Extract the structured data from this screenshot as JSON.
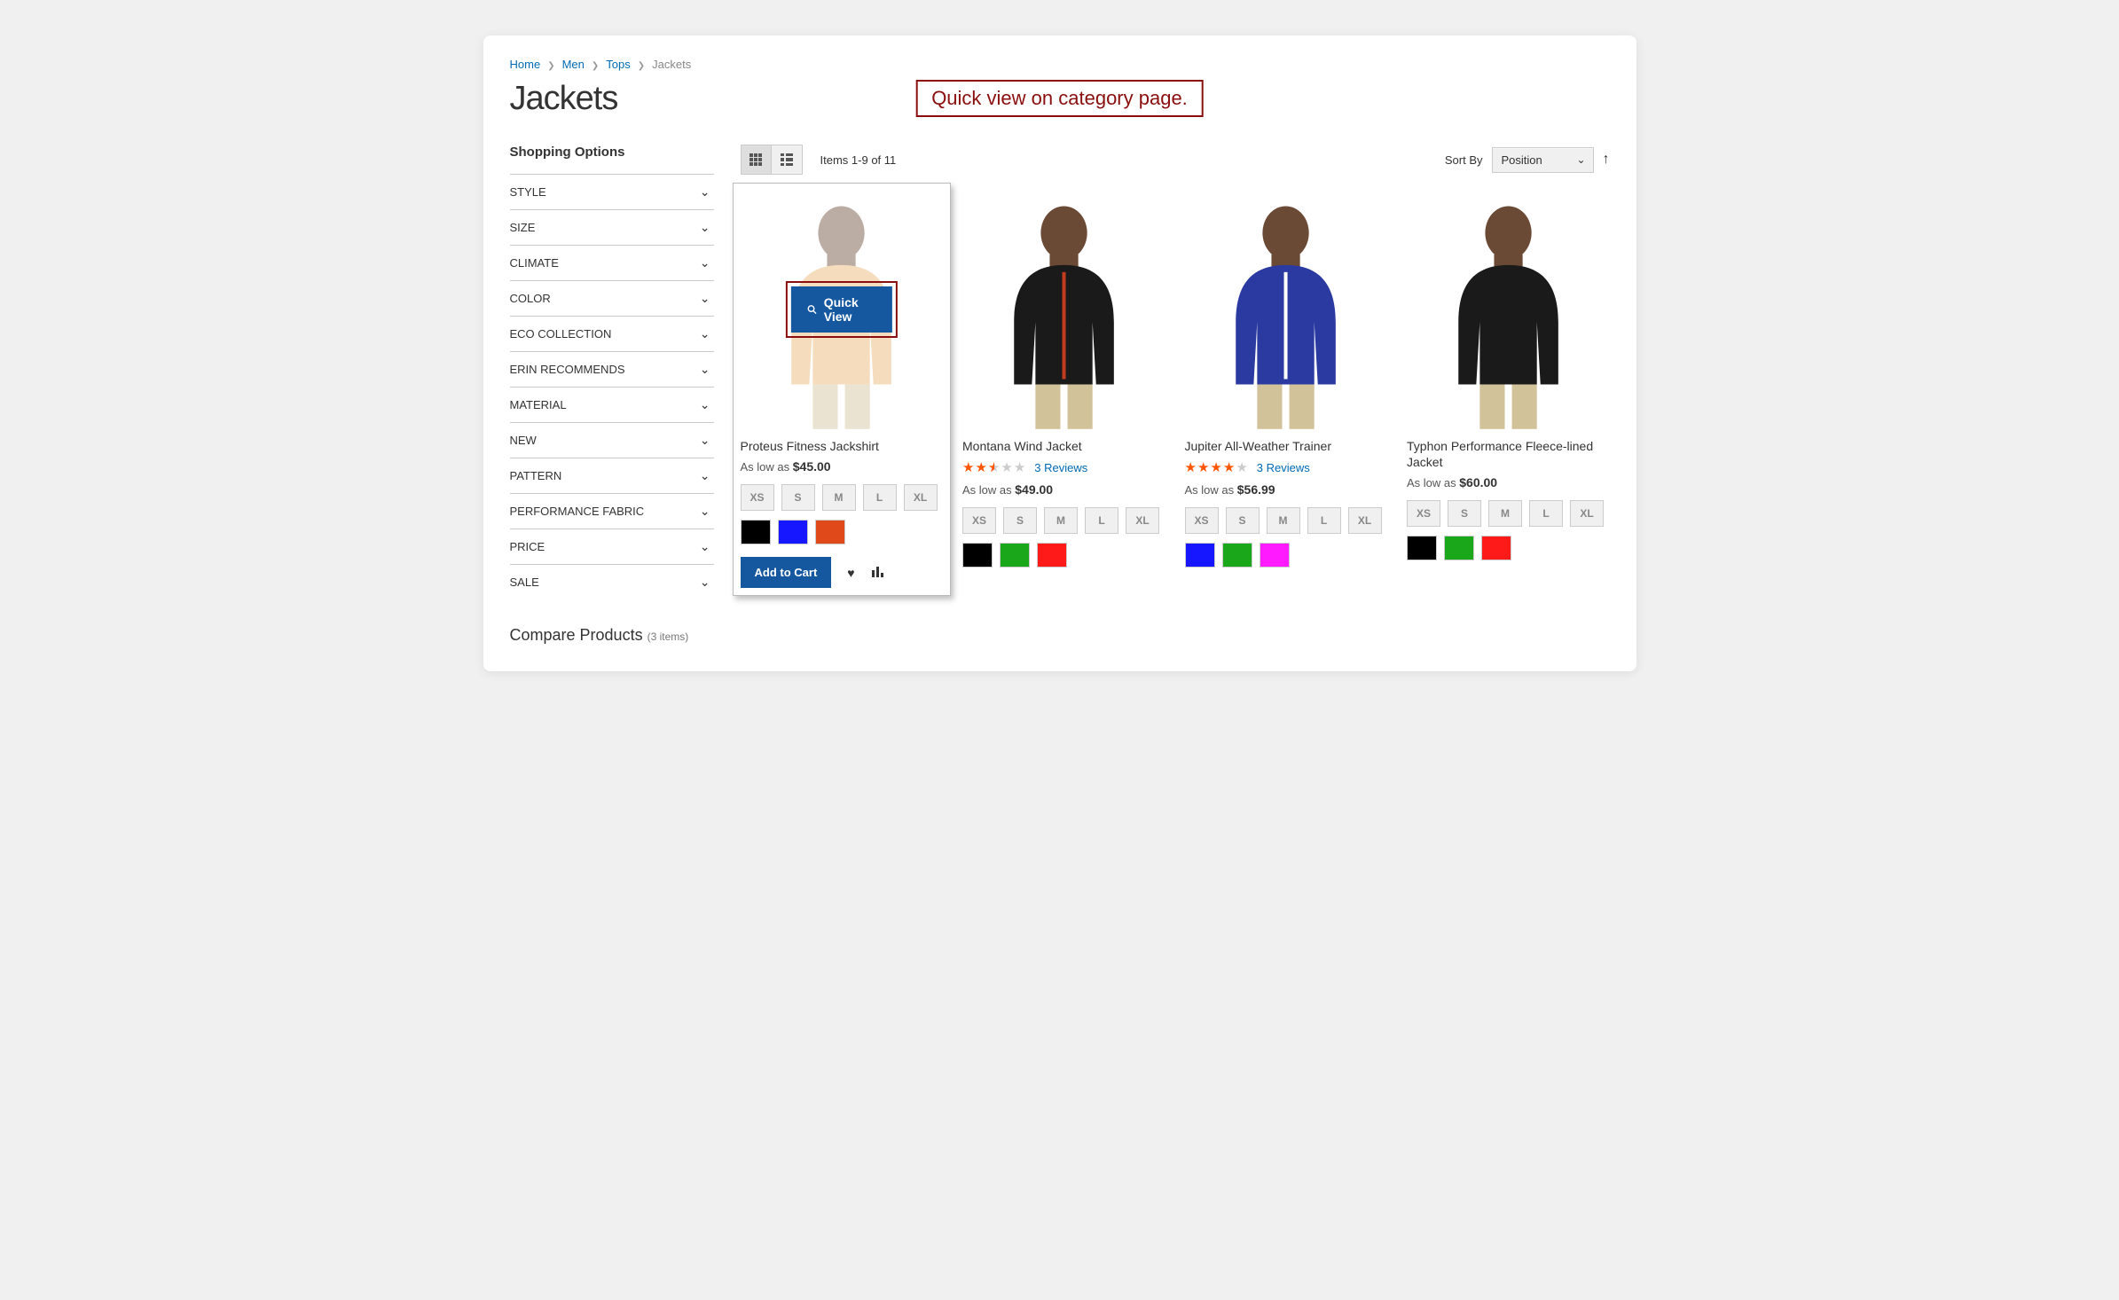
{
  "breadcrumb": [
    {
      "label": "Home",
      "link": true
    },
    {
      "label": "Men",
      "link": true
    },
    {
      "label": "Tops",
      "link": true
    },
    {
      "label": "Jackets",
      "link": false
    }
  ],
  "page_title": "Jackets",
  "callout": "Quick view on category page.",
  "sidebar": {
    "title": "Shopping Options",
    "filters": [
      "STYLE",
      "SIZE",
      "CLIMATE",
      "COLOR",
      "ECO COLLECTION",
      "ERIN RECOMMENDS",
      "MATERIAL",
      "NEW",
      "PATTERN",
      "PERFORMANCE FABRIC",
      "PRICE",
      "SALE"
    ],
    "compare": {
      "label": "Compare Products",
      "count": "(3 items)"
    }
  },
  "toolbar": {
    "amount_prefix": "Items ",
    "amount_range": "1-9",
    "amount_mid": " of ",
    "amount_total": "11",
    "sort_label": "Sort By",
    "sort_value": "Position"
  },
  "quick_view_label": "Quick View",
  "add_to_cart_label": "Add to Cart",
  "as_low_as": "As low as ",
  "reviews_suffix": " Reviews",
  "sizes": [
    "XS",
    "S",
    "M",
    "L",
    "XL"
  ],
  "products": [
    {
      "name": "Proteus Fitness Jackshirt",
      "price": "$45.00",
      "rating": null,
      "reviews": null,
      "colors": [
        "#000000",
        "#1717ff",
        "#e04a1a"
      ],
      "jacket_color": "#e7b26a",
      "hovered": true
    },
    {
      "name": "Montana Wind Jacket",
      "price": "$49.00",
      "rating": 2.5,
      "reviews": 3,
      "colors": [
        "#000000",
        "#1aa81a",
        "#ff1a1a"
      ],
      "jacket_color": "#1a1a1a",
      "zipper": "#c23b1f",
      "hovered": false
    },
    {
      "name": "Jupiter All-Weather Trainer",
      "price": "$56.99",
      "rating": 4,
      "reviews": 3,
      "colors": [
        "#1717ff",
        "#1aa81a",
        "#ff1aff"
      ],
      "jacket_color": "#2a3aa0",
      "zipper": "#ffffff",
      "hovered": false
    },
    {
      "name": "Typhon Performance Fleece-lined Jacket",
      "price": "$60.00",
      "rating": null,
      "reviews": null,
      "colors": [
        "#000000",
        "#1aa81a",
        "#ff1a1a"
      ],
      "jacket_color": "#1a1a1a",
      "hovered": false
    }
  ]
}
